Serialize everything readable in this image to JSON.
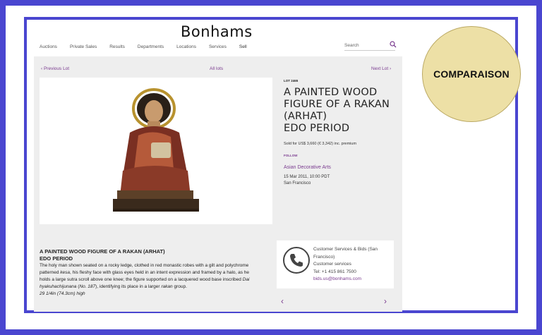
{
  "site": {
    "logo": "Bonhams",
    "nav": [
      "Auctions",
      "Private Sales",
      "Results",
      "Departments",
      "Locations",
      "Services",
      "Sell"
    ],
    "search_placeholder": "Search"
  },
  "lot_nav": {
    "previous": "‹ Previous Lot",
    "all": "All lots",
    "next": "Next Lot ›"
  },
  "lot": {
    "number": "LOT 2465",
    "title_lines": [
      "A PAINTED WOOD",
      "FIGURE OF A RAKAN",
      "(ARHAT)",
      "EDO PERIOD"
    ],
    "sold": "Sold for US$ 3,660 (€ 3,342) inc. premium",
    "follow": "FOLLOW",
    "department": "Asian Decorative Arts",
    "date": "15 Mar 2011, 10:00 PDT",
    "location": "San Francisco"
  },
  "description": {
    "heading1": "A PAINTED WOOD FIGURE OF A RAKAN (ARHAT)",
    "heading2": "EDO PERIOD",
    "body_1": "The holy man shown seated on a rocky ledge, clothed in red monastic robes with a gilt and polychrome patterned ",
    "body_kesa": "kesa",
    "body_2": ", his fleshy face with glass eyes held in an intent expression and framed by a halo, as he holds a large sutra scroll above one knee; the figure supported on a lacquered wood base inscribed ",
    "body_inscr": "Dai hyakuhachijunana",
    "body_3": " (",
    "body_no": "No. 187",
    "body_4": "), identifying its place in a larger ",
    "body_rakan": "rakan",
    "body_5": " group.",
    "dimensions": "29 1/4in (74.3cm) high"
  },
  "contact": {
    "line1": "Customer Services & Bids (San Francisco)",
    "line2": "Customer services",
    "tel": "Tel: +1 415 861 7500",
    "email": "bids.us@bonhams.com"
  },
  "carousel": {
    "prev": "‹",
    "next": "›"
  },
  "badge": {
    "text": "COMPARAISON"
  },
  "colors": {
    "frame": "#4a46d0",
    "accent": "#7a3b8f",
    "badge": "#ede0a6"
  }
}
